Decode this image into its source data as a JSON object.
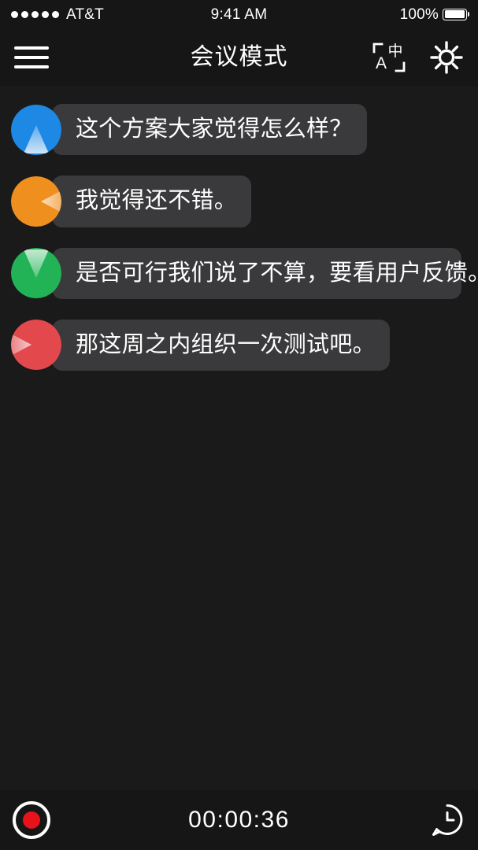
{
  "status_bar": {
    "carrier": "AT&T",
    "signal_dots": 5,
    "time": "9:41 AM",
    "battery_percent": "100%",
    "battery_level": 100
  },
  "header": {
    "menu_icon": "hamburger-menu-icon",
    "title": "会议模式",
    "translate_icon": "translate-icon",
    "translate_icon_text": {
      "latin": "A",
      "cjk": "中"
    },
    "settings_icon": "gear-icon"
  },
  "colors": {
    "background": "#1a1a1a",
    "bar_background": "#161616",
    "bubble": "#3a3a3c",
    "text": "#ffffff",
    "record_red": "#e8131a",
    "speaker_blue": "#1e88e5",
    "speaker_orange": "#ef8f1e",
    "speaker_green": "#23b357",
    "speaker_red": "#e2484c"
  },
  "messages": [
    {
      "avatar_name": "speaker-avatar-north",
      "color": "#1e88e5",
      "direction": "up",
      "text": "这个方案大家觉得怎么样？"
    },
    {
      "avatar_name": "speaker-avatar-west",
      "color": "#ef8f1e",
      "direction": "left",
      "text": "我觉得还不错。"
    },
    {
      "avatar_name": "speaker-avatar-south",
      "color": "#23b357",
      "direction": "down",
      "text": "是否可行我们说了不算，要看用户反馈。"
    },
    {
      "avatar_name": "speaker-avatar-east",
      "color": "#e2484c",
      "direction": "right",
      "text": "那这周之内组织一次测试吧。"
    }
  ],
  "bottom_bar": {
    "record_icon": "record-icon",
    "timer": "00:00:36",
    "history_icon": "history-chat-clock-icon"
  }
}
